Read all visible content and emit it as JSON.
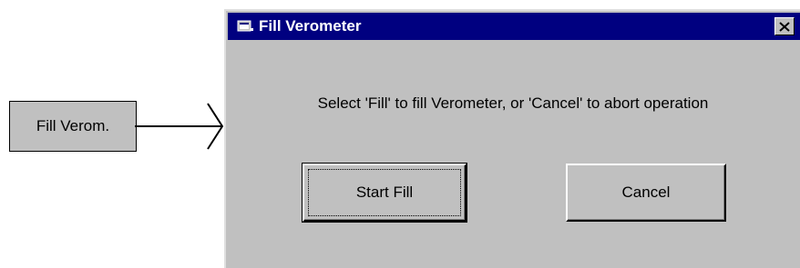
{
  "external_button": {
    "label": "Fill Verom."
  },
  "dialog": {
    "title": "Fill Verometer",
    "message": "Select 'Fill' to fill Verometer, or 'Cancel' to abort operation",
    "start_label": "Start Fill",
    "cancel_label": "Cancel",
    "close_icon": "close-icon",
    "title_icon": "app-icon"
  },
  "colors": {
    "titlebar": "#000080",
    "face": "#c0c0c0",
    "title_text": "#ffffff"
  }
}
